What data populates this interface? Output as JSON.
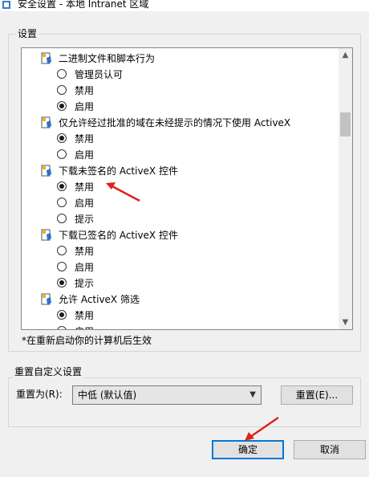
{
  "window": {
    "title": "安全设置 - 本地 Intranet 区域"
  },
  "settings_group": {
    "label": "设置",
    "items": [
      {
        "kind": "setting",
        "label": "二进制文件和脚本行为"
      },
      {
        "kind": "option",
        "label": "管理员认可",
        "checked": false
      },
      {
        "kind": "option",
        "label": "禁用",
        "checked": false
      },
      {
        "kind": "option",
        "label": "启用",
        "checked": true
      },
      {
        "kind": "setting",
        "label": "仅允许经过批准的域在未经提示的情况下使用 ActiveX"
      },
      {
        "kind": "option",
        "label": "禁用",
        "checked": true
      },
      {
        "kind": "option",
        "label": "启用",
        "checked": false
      },
      {
        "kind": "setting",
        "label": "下载未签名的 ActiveX 控件"
      },
      {
        "kind": "option",
        "label": "禁用",
        "checked": true
      },
      {
        "kind": "option",
        "label": "启用",
        "checked": false
      },
      {
        "kind": "option",
        "label": "提示",
        "checked": false
      },
      {
        "kind": "setting",
        "label": "下载已签名的 ActiveX 控件"
      },
      {
        "kind": "option",
        "label": "禁用",
        "checked": false
      },
      {
        "kind": "option",
        "label": "启用",
        "checked": false
      },
      {
        "kind": "option",
        "label": "提示",
        "checked": true
      },
      {
        "kind": "setting",
        "label": "允许 ActiveX 筛选"
      },
      {
        "kind": "option",
        "label": "禁用",
        "checked": true
      },
      {
        "kind": "option",
        "label": "启用",
        "checked": false
      }
    ],
    "restart_note": "*在重新启动你的计算机后生效"
  },
  "reset_group": {
    "label": "重置自定义设置",
    "reset_to_label": "重置为(R):",
    "selected_level": "中低 (默认值)",
    "reset_button": "重置(E)..."
  },
  "buttons": {
    "ok": "确定",
    "cancel": "取消"
  },
  "colors": {
    "annotation_arrow": "#e02020",
    "focus_border": "#0078d7"
  }
}
